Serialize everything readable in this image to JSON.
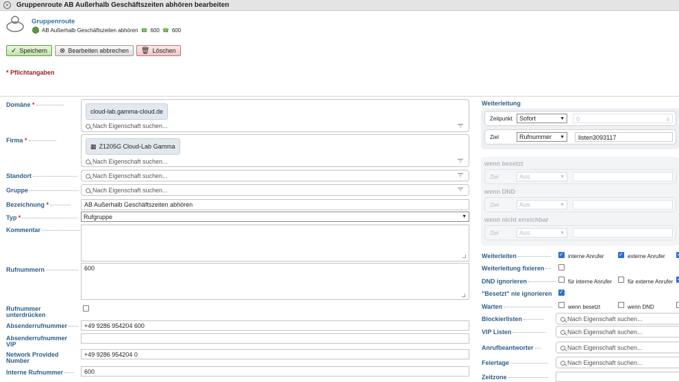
{
  "title": "Gruppenroute AB Außerhalb Geschäftszeiten abhören bearbeiten",
  "header": {
    "type_label": "Gruppenroute",
    "name": "AB Außerhalb Geschäftszeiten abhören",
    "phone1": "600",
    "phone2": "600"
  },
  "toolbar": {
    "save": "Speichern",
    "cancel": "Bearbeiten abbrechen",
    "delete": "Löschen"
  },
  "required_note": "* Pflichtangaben",
  "form": {
    "domaene": {
      "label": "Domäne",
      "value": "cloud-lab.gamma-cloud.de",
      "search": "Nach Eigenschaft suchen..."
    },
    "firma": {
      "label": "Firma",
      "value": "Z1205G Cloud-Lab Gamma",
      "search": "Nach Eigenschaft suchen..."
    },
    "standort": {
      "label": "Standort",
      "search": "Nach Eigenschaft suchen..."
    },
    "gruppe": {
      "label": "Gruppe",
      "search": "Nach Eigenschaft suchen..."
    },
    "bezeichnung": {
      "label": "Bezeichnung",
      "value": "AB Außerhalb Geschäftszeiten abhören"
    },
    "typ": {
      "label": "Typ",
      "value": "Rufgruppe"
    },
    "kommentar": {
      "label": "Kommentar",
      "value": ""
    },
    "rufnummern": {
      "label": "Rufnummern",
      "value": "600"
    },
    "unterdruecken": {
      "label_line1": "Rufnummer",
      "label_line2": "unterdrücken"
    },
    "absender": {
      "label": "Absenderrufnummer",
      "value": "+49 9286 954204 600"
    },
    "absender_vip": {
      "label_line1": "Absenderrufnummer",
      "label_line2": "VIP",
      "value": ""
    },
    "npn": {
      "label_line1": "Network Provided",
      "label_line2": "Number",
      "value": "+49 9286 954204 0"
    },
    "interne": {
      "label": "Interne Rufnummer",
      "value": "600"
    }
  },
  "weiterleitung": {
    "title": "Weiterleitung",
    "zeitpunkt_label": "Zeitpunkt",
    "zeitpunkt_value": "Sofort",
    "delay_value": "0",
    "delay_unit": "s",
    "ziel_label": "Ziel",
    "ziel_type": "Rufnummer",
    "ziel_value": "listen3093117",
    "besetzt": {
      "title": "wenn besetzt",
      "ziel_label": "Ziel",
      "value": "Aus"
    },
    "dnd": {
      "title": "wenn DND",
      "ziel_label": "Ziel",
      "value": "Aus"
    },
    "nicht": {
      "title": "wenn nicht erreichbar",
      "ziel_label": "Ziel",
      "value": "Aus"
    }
  },
  "options": {
    "weiterleiten": {
      "label": "Weiterleiten",
      "opt1": "interne Anrufer",
      "opt2": "externe Anrufer"
    },
    "fixieren": {
      "label": "Weiterleitung fixieren"
    },
    "dnd": {
      "label": "DND ignorieren",
      "opt1": "für interne Anrufer",
      "opt2": "für externe Anrufer"
    },
    "besetzt": {
      "label": "\"Besetzt\" nie ignorieren"
    },
    "warten": {
      "label": "Warten",
      "opt1": "wenn besetzt",
      "opt2": "wenn DND"
    },
    "blockier": {
      "label": "Blockierlisten",
      "search": "Nach Eigenschaft suchen..."
    },
    "vip": {
      "label": "VIP Listen",
      "search": "Nach Eigenschaft suchen..."
    },
    "anruf": {
      "label": "Anrufbeantworter",
      "search": "Nach Eigenschaft suchen..."
    },
    "feiertage": {
      "label": "Feiertage",
      "search": "Nach Eigenschaft suchen..."
    },
    "zeitzone": {
      "label": "Zeitzone"
    }
  },
  "colors": {
    "accent": "#2e5e8d",
    "required": "#c0282e",
    "checkbox": "#2f6fd0"
  }
}
